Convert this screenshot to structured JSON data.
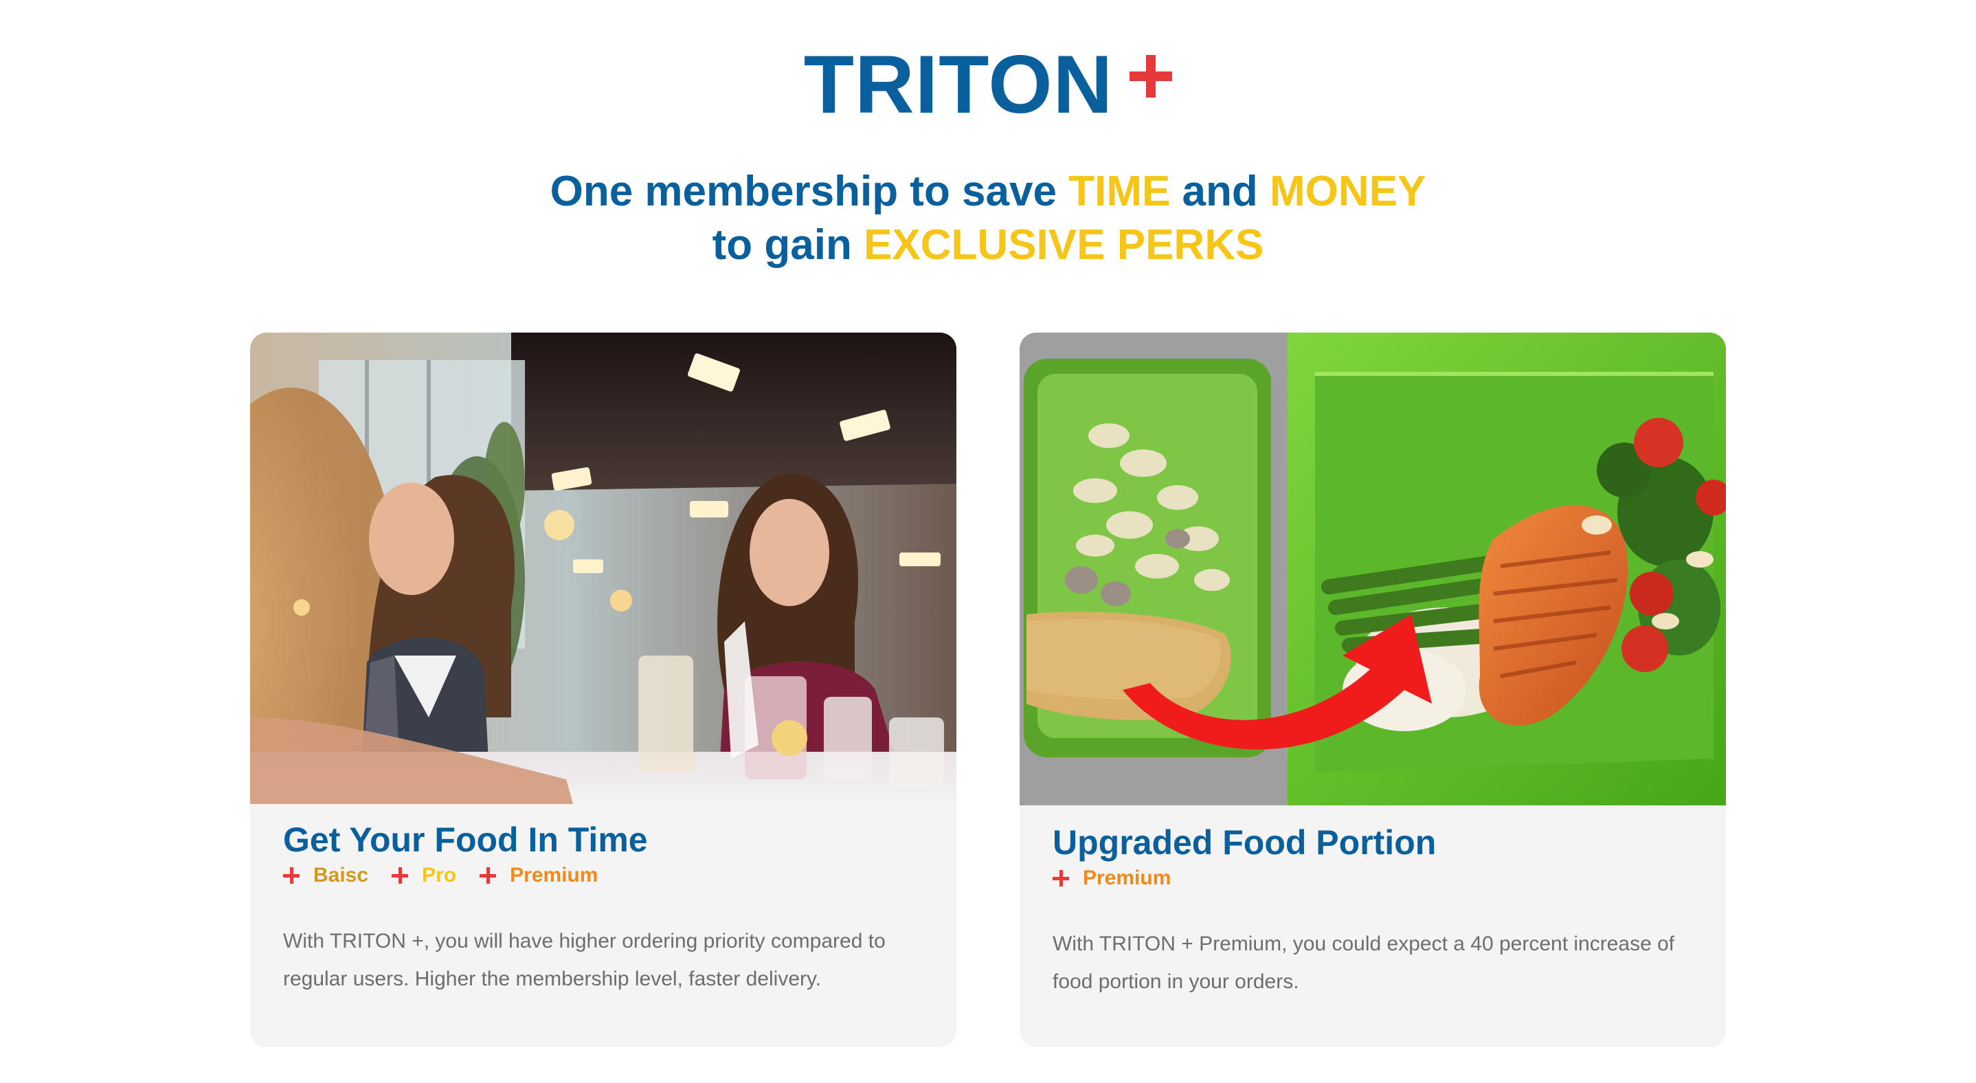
{
  "header": {
    "brand_name": "TRITON",
    "brand_symbol": "+",
    "tagline_line1": {
      "part1": "One membership to save ",
      "highlight1": "TIME",
      "part2": " and ",
      "highlight2": "MONEY"
    },
    "tagline_line2": {
      "part1": "to gain ",
      "highlight1": "EXCLUSIVE PERKS"
    }
  },
  "cards": [
    {
      "title": "Get Your Food In Time",
      "image": "friends-dining-at-restaurant",
      "tiers": [
        {
          "label": "Baisc",
          "color": "#d19a1c"
        },
        {
          "label": "Pro",
          "color": "#f5c518"
        },
        {
          "label": "Premium",
          "color": "#f08a1c"
        }
      ],
      "description": "With TRITON +, you will have higher ordering priority compared to regular users. Higher the membership level, faster delivery."
    },
    {
      "title": "Upgraded Food Portion",
      "image": "food-portion-before-after",
      "tiers": [
        {
          "label": "Premium",
          "color": "#f08a1c"
        }
      ],
      "description": "With TRITON + Premium, you could expect a 40 percent increase of food portion in your orders."
    }
  ],
  "colors": {
    "brand_blue": "#0a5f9d",
    "accent_yellow": "#f5c518",
    "plus_red": "#e8393a",
    "card_bg": "#f4f4f4",
    "body_text": "#6d6d6d"
  }
}
